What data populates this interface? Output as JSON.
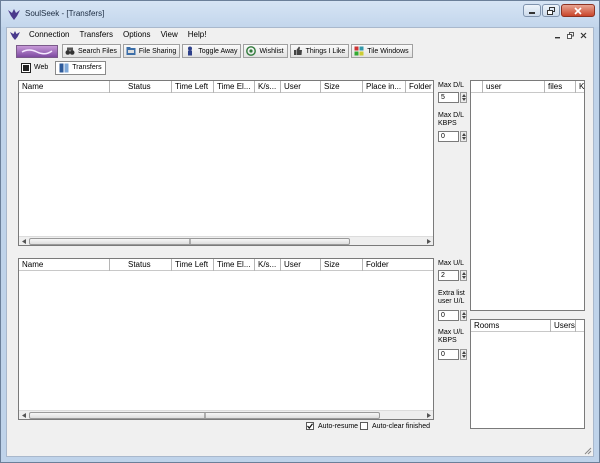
{
  "window": {
    "title": "SoulSeek - [Transfers]",
    "colors": {
      "frame": "#bfd3ea",
      "client": "#f0f0f0",
      "close": "#c9452b",
      "logo": "#7e4aa2"
    }
  },
  "menu": {
    "items": [
      "Connection",
      "Transfers",
      "Options",
      "View",
      "Help!"
    ]
  },
  "toolbar": {
    "logo_icon": "soulseek-logo",
    "buttons": [
      {
        "label": "Search Files",
        "icon": "binoculars-icon"
      },
      {
        "label": "File Sharing",
        "icon": "folder-icon"
      },
      {
        "label": "Toggle Away",
        "icon": "person-icon"
      },
      {
        "label": "Wishlist",
        "icon": "wishlist-icon"
      },
      {
        "label": "Things I Like",
        "icon": "thumb-icon"
      },
      {
        "label": "Tile Windows",
        "icon": "tile-icon"
      }
    ]
  },
  "tabs": [
    {
      "label": "Web",
      "icon": "web-icon",
      "active": false
    },
    {
      "label": "Transfers",
      "icon": "transfers-icon",
      "active": true
    }
  ],
  "downloads": {
    "columns": [
      "Name",
      "Status",
      "Time Left",
      "Time El...",
      "K/s...",
      "User",
      "Size",
      "Place in...",
      "Folder"
    ],
    "max_dl_label": "Max D/L",
    "max_dl_value": "5",
    "max_dl_kbps_label": "Max D/L KBPS",
    "max_dl_kbps_value": "0"
  },
  "uploads": {
    "columns": [
      "Name",
      "Status",
      "Time Left",
      "Time El...",
      "K/s...",
      "User",
      "Size",
      "Folder"
    ],
    "max_ul_label": "Max U/L",
    "max_ul_value": "2",
    "extra_list_label": "Extra list user U/L",
    "extra_list_value": "0",
    "max_ul_kbps_label": "Max U/L KBPS",
    "max_ul_kbps_value": "0"
  },
  "users_panel": {
    "columns": [
      "user",
      "files",
      "K"
    ]
  },
  "rooms_panel": {
    "columns": [
      "Rooms",
      "Users"
    ]
  },
  "options": {
    "auto_resume": {
      "label": "Auto-resume",
      "checked": true
    },
    "auto_clear": {
      "label": "Auto-clear finished",
      "checked": false
    }
  }
}
